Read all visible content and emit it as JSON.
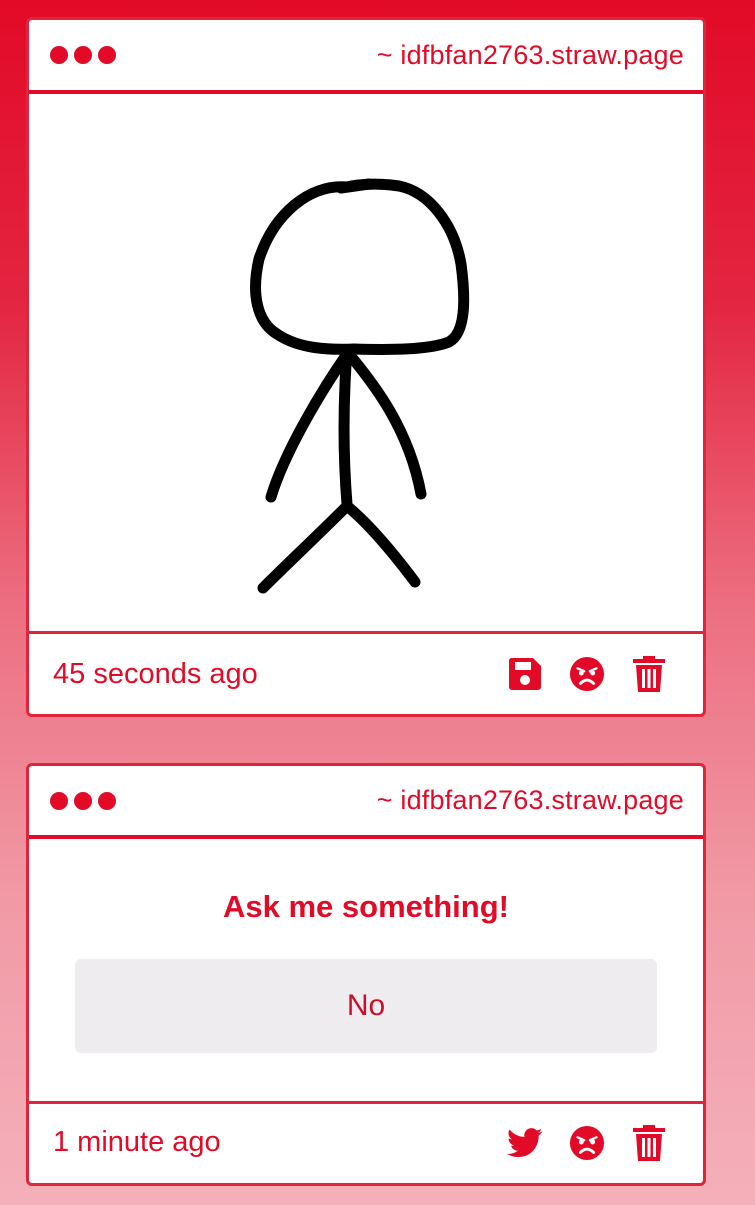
{
  "colors": {
    "accent": "#e20a27",
    "card_background": "#ffffff",
    "answer_background": "#eeecee",
    "drawing_stroke": "#000000"
  },
  "cards": [
    {
      "handle": "~ idfbfan2763.straw.page",
      "type": "drawing",
      "drawing": "stick-figure",
      "timestamp": "45 seconds ago",
      "actions": [
        "save-icon",
        "angry-face-icon",
        "trash-icon"
      ]
    },
    {
      "handle": "~ idfbfan2763.straw.page",
      "type": "question",
      "question": "Ask me something!",
      "answer": "No",
      "timestamp": "1 minute ago",
      "actions": [
        "twitter-icon",
        "angry-face-icon",
        "trash-icon"
      ]
    }
  ]
}
